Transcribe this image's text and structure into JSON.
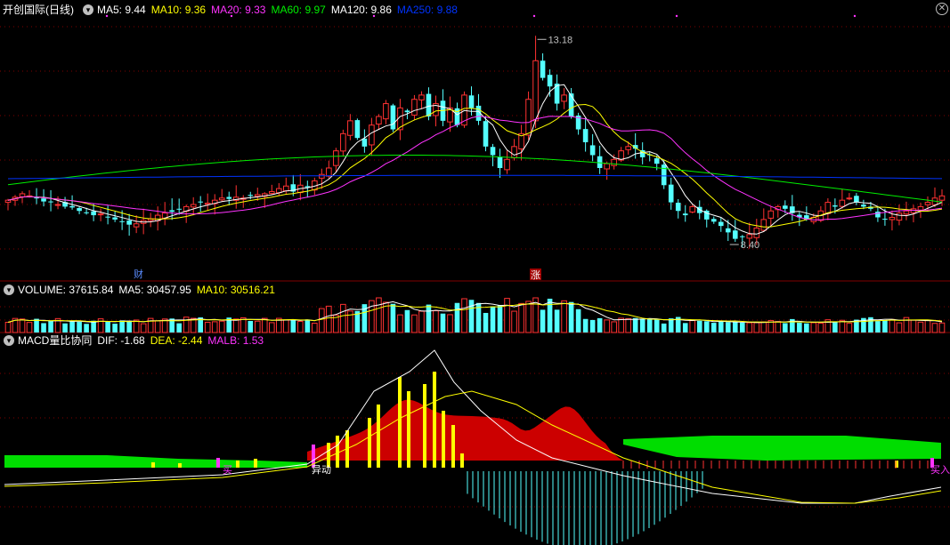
{
  "price_panel": {
    "stock_name": "开创国际(日线)",
    "indicators": [
      {
        "text": "MA5: 9.44",
        "color": "#ffffff"
      },
      {
        "text": "MA10: 9.36",
        "color": "#ffff00"
      },
      {
        "text": "MA20: 9.33",
        "color": "#ff33ff"
      },
      {
        "text": "MA60: 9.97",
        "color": "#00ee00"
      },
      {
        "text": "MA120: 9.86",
        "color": "#ffffff"
      },
      {
        "text": "MA250: 9.88",
        "color": "#0033ff"
      }
    ],
    "high_label": "13.18",
    "low_label": "8.40",
    "marker_cai": "财",
    "marker_zhang": "涨"
  },
  "volume_panel": {
    "indicators": [
      {
        "text": "VOLUME: 37615.84",
        "color": "#ffffff"
      },
      {
        "text": "MA5: 30457.95",
        "color": "#ffffff"
      },
      {
        "text": "MA10: 30516.21",
        "color": "#ffff00"
      }
    ]
  },
  "macd_panel": {
    "indicators": [
      {
        "text": "MACD量比协同",
        "color": "#ffffff"
      },
      {
        "text": "DIF: -1.68",
        "color": "#ffffff"
      },
      {
        "text": "DEA: -2.44",
        "color": "#ffff00"
      },
      {
        "text": "MALB: 1.53",
        "color": "#ff33ff"
      }
    ],
    "signal_label_1": "异动",
    "signal_label_2": "买",
    "signal_label_3": "买入"
  },
  "colors": {
    "up": "#ff3232",
    "down": "#54ffff",
    "grid": "#800000",
    "ma5": "#ffffff",
    "ma10": "#ffff00",
    "ma20": "#ff33ff",
    "ma60": "#00ee00",
    "ma250": "#0033ff",
    "macd_red": "#cc0000",
    "macd_green": "#00dd00"
  },
  "chart_data": {
    "type": "candlestick",
    "price_range": [
      7.8,
      13.6
    ],
    "closes": [
      9.35,
      9.42,
      9.5,
      9.45,
      9.4,
      9.32,
      9.3,
      9.25,
      9.2,
      9.18,
      9.1,
      9.05,
      9.0,
      9.03,
      8.95,
      8.9,
      8.85,
      8.78,
      8.8,
      8.88,
      8.92,
      9.0,
      9.05,
      9.08,
      9.15,
      9.2,
      9.25,
      9.3,
      9.28,
      9.35,
      9.4,
      9.38,
      9.42,
      9.4,
      9.45,
      9.48,
      9.5,
      9.55,
      9.62,
      9.68,
      9.55,
      9.7,
      9.65,
      9.8,
      9.95,
      10.1,
      10.5,
      10.9,
      11.2,
      10.8,
      10.6,
      11.1,
      11.3,
      11.6,
      11.0,
      11.5,
      11.4,
      11.7,
      11.8,
      11.3,
      11.6,
      11.2,
      11.5,
      11.1,
      11.8,
      11.5,
      11.2,
      10.6,
      10.4,
      10.1,
      10.3,
      10.6,
      10.9,
      11.7,
      12.6,
      12.2,
      12.0,
      11.6,
      11.8,
      11.3,
      11.0,
      10.7,
      10.4,
      10.1,
      10.2,
      10.3,
      10.5,
      10.6,
      10.55,
      10.35,
      10.4,
      10.2,
      9.7,
      9.3,
      9.1,
      9.0,
      9.2,
      9.05,
      8.9,
      8.85,
      8.75,
      8.6,
      8.45,
      8.5,
      8.55,
      8.7,
      8.9,
      9.1,
      9.2,
      9.15,
      9.05,
      8.95,
      8.9,
      8.95,
      9.1,
      9.3,
      9.2,
      9.35,
      9.4,
      9.3,
      9.2,
      9.15,
      8.95,
      8.9,
      8.95,
      9.05,
      9.1,
      9.15,
      9.2,
      9.3,
      9.4,
      9.45
    ],
    "event_high": 13.18,
    "event_low": 8.4
  }
}
